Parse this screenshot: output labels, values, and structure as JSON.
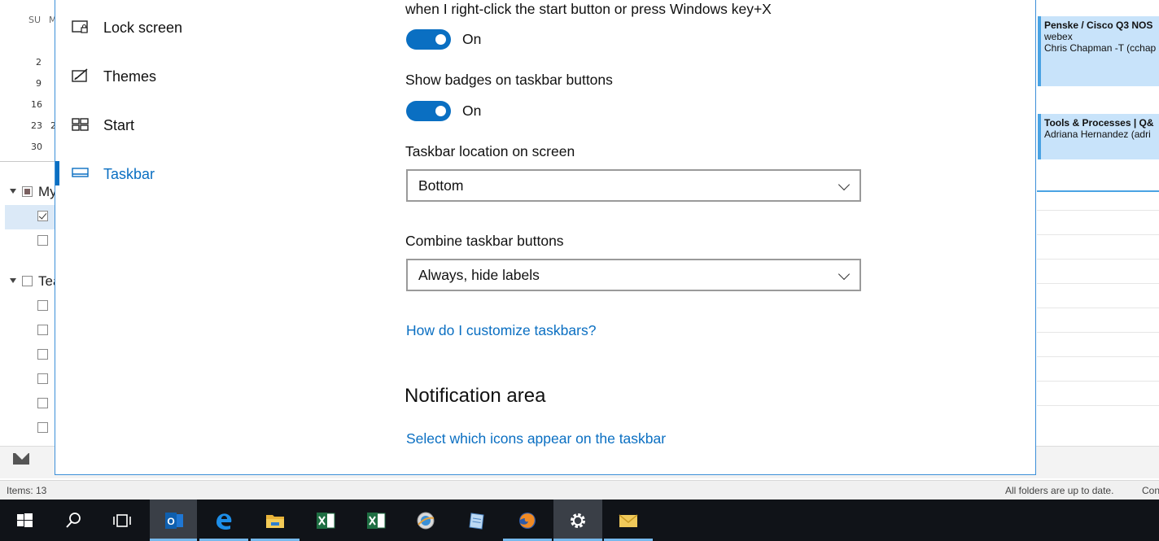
{
  "background_app": {
    "calendar": {
      "day_headers": [
        "SU",
        "M"
      ],
      "week_starts": [
        "2",
        "9",
        "16",
        "23",
        "30"
      ],
      "partial_second_col": [
        "",
        "",
        "",
        "2",
        ""
      ]
    },
    "groups": {
      "my_label": "My",
      "team_label": "Tea"
    },
    "appointments": [
      {
        "title": "Penske / Cisco Q3 NOS",
        "line2": "webex",
        "line3": "Chris Chapman -T (cchap"
      },
      {
        "title": "Tools & Processes | Q&",
        "line2": "Adriana Hernandez (adri",
        "line3": ""
      }
    ],
    "status": {
      "items": "Items: 13",
      "sync": "All folders are up to date.",
      "conn": "Con"
    }
  },
  "settings": {
    "nav": [
      {
        "label": "Lock screen",
        "icon": "lock-screen-icon"
      },
      {
        "label": "Themes",
        "icon": "themes-icon"
      },
      {
        "label": "Start",
        "icon": "start-icon"
      },
      {
        "label": "Taskbar",
        "icon": "taskbar-icon"
      }
    ],
    "content": {
      "winx_text": "when I right-click the start button or press Windows key+X",
      "winx_toggle": "On",
      "badges_label": "Show badges on taskbar buttons",
      "badges_toggle": "On",
      "location_label": "Taskbar location on screen",
      "location_value": "Bottom",
      "combine_label": "Combine taskbar buttons",
      "combine_value": "Always, hide labels",
      "help_link": "How do I customize taskbars?",
      "notification_heading": "Notification area",
      "select_icons_link": "Select which icons appear on the taskbar"
    }
  },
  "taskbar": {
    "items": [
      "windows-start-icon",
      "search-icon",
      "task-view-icon",
      "outlook-icon",
      "edge-icon",
      "file-explorer-icon",
      "excel-icon",
      "excel-icon-2",
      "app-globe-icon",
      "notepad-icon",
      "firefox-icon",
      "settings-gear-icon",
      "mail-icon"
    ],
    "accent": "#76b9ed",
    "outlook_badge": "O"
  },
  "colors": {
    "accent_blue": "#0a6fc2",
    "taskbar_bg": "#101318"
  }
}
